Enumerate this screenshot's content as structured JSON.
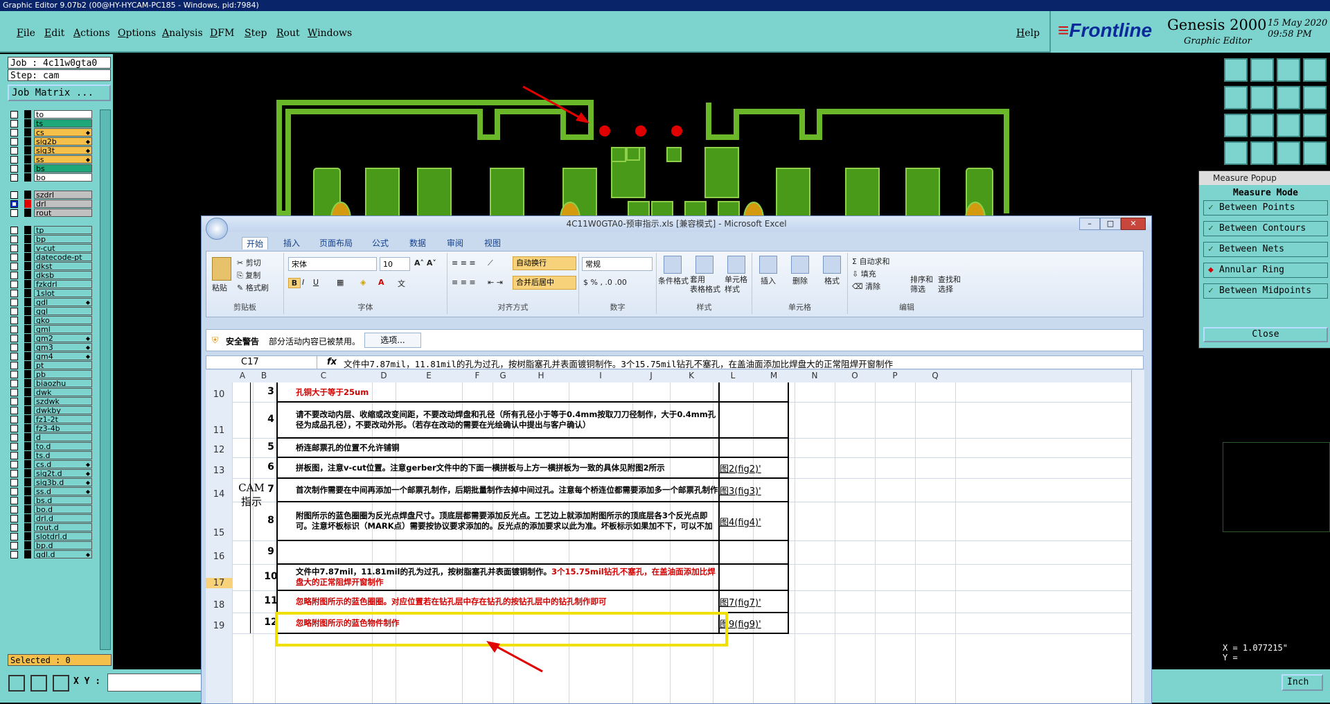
{
  "genesis": {
    "title_bar": "Graphic Editor 9.07b2 (00@HY-HYCAM-PC185 - Windows, pid:7984)",
    "menu": [
      "File",
      "Edit",
      "Actions",
      "Options",
      "Analysis",
      "DFM",
      "Step",
      "Rout",
      "Windows"
    ],
    "help": "Help",
    "brand": {
      "logo": "Frontline",
      "product": "Genesis 2000",
      "subtitle": "Graphic Editor",
      "date": "15 May 2020",
      "time": "09:58 PM"
    },
    "job": "Job : 4c11w0gta0",
    "step": "Step: cam",
    "job_matrix": "Job Matrix ...",
    "selected": "Selected : 0",
    "xy_label": "X Y :",
    "units": "Inch",
    "coord_x": "X = 1.077215\"",
    "coord_y": "Y =",
    "lang": "EN"
  },
  "layers": [
    {
      "name": "to",
      "color": "#ffffff",
      "tick": false
    },
    {
      "name": "ts",
      "color": "#1ea87a",
      "tick": false
    },
    {
      "name": "cs",
      "color": "#f4c04a",
      "tick": true
    },
    {
      "name": "sig2b",
      "color": "#f4c04a",
      "tick": true
    },
    {
      "name": "sig3t",
      "color": "#f4c04a",
      "tick": true
    },
    {
      "name": "ss",
      "color": "#f4c04a",
      "tick": true
    },
    {
      "name": "bs",
      "color": "#1ea87a",
      "tick": false
    },
    {
      "name": "bo",
      "color": "#ffffff",
      "tick": false
    },
    {
      "name": "szdrl",
      "color": "#c0c0c0",
      "tick": false
    },
    {
      "name": "drl",
      "color": "#c0c0c0",
      "tick": false,
      "active": true
    },
    {
      "name": "rout",
      "color": "#c0c0c0",
      "tick": false
    },
    {
      "name": "tp",
      "color": "#7dd4cf",
      "tick": false
    },
    {
      "name": "bp",
      "color": "#7dd4cf",
      "tick": false
    },
    {
      "name": "v-cut",
      "color": "#7dd4cf",
      "tick": false
    },
    {
      "name": "datecode-pt",
      "color": "#7dd4cf",
      "tick": false
    },
    {
      "name": "dkst",
      "color": "#7dd4cf",
      "tick": false
    },
    {
      "name": "dksb",
      "color": "#7dd4cf",
      "tick": false
    },
    {
      "name": "fzkdrl",
      "color": "#7dd4cf",
      "tick": false
    },
    {
      "name": "1slot",
      "color": "#7dd4cf",
      "tick": false
    },
    {
      "name": "gdl",
      "color": "#7dd4cf",
      "tick": true
    },
    {
      "name": "ggl",
      "color": "#7dd4cf",
      "tick": false
    },
    {
      "name": "gko",
      "color": "#7dd4cf",
      "tick": false
    },
    {
      "name": "gml",
      "color": "#7dd4cf",
      "tick": false
    },
    {
      "name": "gm2",
      "color": "#7dd4cf",
      "tick": true
    },
    {
      "name": "gm3",
      "color": "#7dd4cf",
      "tick": true
    },
    {
      "name": "gm4",
      "color": "#7dd4cf",
      "tick": true
    },
    {
      "name": "pt",
      "color": "#7dd4cf",
      "tick": false
    },
    {
      "name": "pb",
      "color": "#7dd4cf",
      "tick": false
    },
    {
      "name": "biaozhu",
      "color": "#7dd4cf",
      "tick": false
    },
    {
      "name": "dwk",
      "color": "#7dd4cf",
      "tick": false
    },
    {
      "name": "szdwk",
      "color": "#7dd4cf",
      "tick": false
    },
    {
      "name": "dwkby",
      "color": "#7dd4cf",
      "tick": false
    },
    {
      "name": "fz1-2t",
      "color": "#7dd4cf",
      "tick": false
    },
    {
      "name": "fz3-4b",
      "color": "#7dd4cf",
      "tick": false
    },
    {
      "name": "d",
      "color": "#7dd4cf",
      "tick": false
    },
    {
      "name": "to.d",
      "color": "#7dd4cf",
      "tick": false
    },
    {
      "name": "ts.d",
      "color": "#7dd4cf",
      "tick": false
    },
    {
      "name": "cs.d",
      "color": "#7dd4cf",
      "tick": true
    },
    {
      "name": "sig2t.d",
      "color": "#7dd4cf",
      "tick": true
    },
    {
      "name": "sig3b.d",
      "color": "#7dd4cf",
      "tick": true
    },
    {
      "name": "ss.d",
      "color": "#7dd4cf",
      "tick": true
    },
    {
      "name": "bs.d",
      "color": "#7dd4cf",
      "tick": false
    },
    {
      "name": "bo.d",
      "color": "#7dd4cf",
      "tick": false
    },
    {
      "name": "drl.d",
      "color": "#7dd4cf",
      "tick": false
    },
    {
      "name": "rout.d",
      "color": "#7dd4cf",
      "tick": false
    },
    {
      "name": "slotdrl.d",
      "color": "#7dd4cf",
      "tick": false
    },
    {
      "name": "bp.d",
      "color": "#7dd4cf",
      "tick": false
    },
    {
      "name": "gdl.d",
      "color": "#7dd4cf",
      "tick": true
    }
  ],
  "measure_popup": {
    "title": "Measure Popup",
    "header": "Measure Mode",
    "options": [
      "Between Points",
      "Between Contours",
      "Between Nets",
      "Annular Ring",
      "Between Midpoints"
    ],
    "selected": "Annular Ring",
    "close": "Close"
  },
  "excel": {
    "title": "4C11W0GTA0-预审指示.xls  [兼容模式] - Microsoft Excel",
    "tabs": [
      "开始",
      "插入",
      "页面布局",
      "公式",
      "数据",
      "审阅",
      "视图"
    ],
    "ribbon": {
      "clipboard": {
        "paste": "粘贴",
        "cut": "剪切",
        "copy": "复制",
        "format_painter": "格式刷",
        "label": "剪贴板"
      },
      "font": {
        "name": "宋体",
        "size": "10",
        "label": "字体"
      },
      "alignment": {
        "wrap": "自动换行",
        "merge": "合并后居中",
        "label": "对齐方式"
      },
      "number": {
        "format": "常规",
        "label": "数字"
      },
      "styles": {
        "conditional": "条件格式",
        "table": "套用\n表格格式",
        "cell": "单元格\n样式",
        "label": "样式"
      },
      "cells": {
        "insert": "插入",
        "delete": "删除",
        "format": "格式",
        "label": "单元格"
      },
      "editing": {
        "autosum": "自动求和",
        "fill": "填充",
        "clear": "清除",
        "sort": "排序和\n筛选",
        "find": "查找和\n选择",
        "label": "编辑"
      }
    },
    "security": {
      "title": "安全警告",
      "message": "部分活动内容已被禁用。",
      "options": "选项..."
    },
    "name_box": "C17",
    "formula": "文件中7.87mil，11.81mil的孔为过孔，按树脂塞孔并表面镀铜制作。3个15.75mil钻孔不塞孔，在盖油面添加比焊盘大的正常阻焊开窗制作",
    "columns": [
      "A",
      "B",
      "C",
      "D",
      "E",
      "F",
      "G",
      "H",
      "I",
      "J",
      "K",
      "L",
      "M",
      "N",
      "O",
      "P",
      "Q"
    ],
    "section_label": "CAM\n指示",
    "rows": [
      {
        "row": "10",
        "num": "3",
        "text": "孔铜大于等于25um",
        "red": true,
        "fig": ""
      },
      {
        "row": "11",
        "num": "4",
        "text": "请不要改动内层、收缩或改变间距，不要改动焊盘和孔径（所有孔径小于等于0.4mm按取刀刀径制作，大于0.4mm孔径为成品孔径），不要改动外形。（若存在改动的需要在光绘确认中提出与客户确认）",
        "red": false,
        "fig": ""
      },
      {
        "row": "12",
        "num": "5",
        "text": "桥连邮票孔的位置不允许铺铜",
        "red": false,
        "fig": ""
      },
      {
        "row": "13",
        "num": "6",
        "text": "拼板图，注意v-cut位置。注意gerber文件中的下面一横拼板与上方一横拼板为一致的具体见附图2所示",
        "red": false,
        "fig": "图2(fig2)'"
      },
      {
        "row": "14",
        "num": "7",
        "text": "首次制作需要在中间再添加一个邮票孔制作，后期批量制作去掉中间过孔。注意每个桥连位都需要添加多一个邮票孔制作",
        "red": false,
        "fig": "图3(fig3)'"
      },
      {
        "row": "15",
        "num": "8",
        "text": "附图所示的蓝色圈圈为反光点焊盘尺寸。顶底层都需要添加反光点。工艺边上就添加附图所示的顶底层各3个反光点即可。注意坏板标识（MARK点）需要按协议要求添加的。反光点的添加要求以此为准。坏板标示如果加不下，可以不加",
        "red": false,
        "fig": "图4(fig4)'"
      },
      {
        "row": "16",
        "num": "9",
        "text": "",
        "red": false,
        "fig": ""
      },
      {
        "row": "17",
        "num": "10",
        "text_black": "文件中7.87mil，11.81mil的孔为过孔，按树脂塞孔并表面镀铜制作。",
        "text_red": "3个15.75mil钻孔不塞孔，在盖油面添加比焊盘大的正常阻焊开窗制作",
        "fig": ""
      },
      {
        "row": "18",
        "num": "11",
        "text": "忽略附图所示的蓝色圈圈。对应位置若在钻孔层中存在钻孔的按钻孔层中的钻孔制作即可",
        "red": true,
        "fig": "图7(fig7)'"
      },
      {
        "row": "19",
        "num": "12",
        "text": "忽略附图所示的蓝色物件制作",
        "red": true,
        "fig": "图9(fig9)'"
      }
    ]
  }
}
